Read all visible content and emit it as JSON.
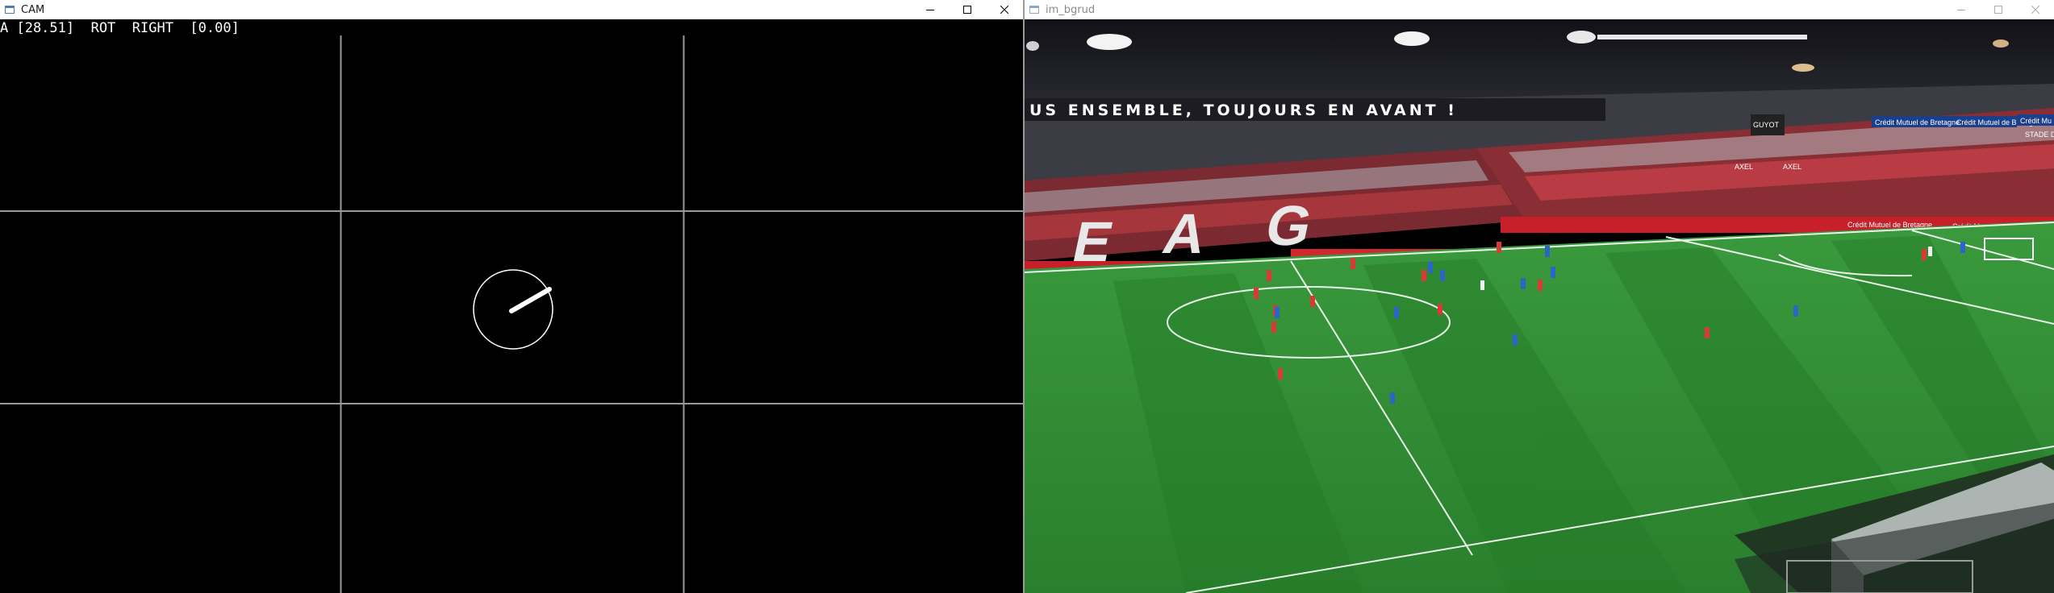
{
  "windows": {
    "cam": {
      "title": "CAM",
      "readout": "A [28.51]  ROT  RIGHT  [0.00]",
      "line_color": "#9a9a9a",
      "gauge_color": "#ffffff"
    },
    "bgrud": {
      "title": "im_bgrud",
      "banner_text": "US  ENSEMBLE,  TOUJOURS  EN  AVANT !",
      "stand_letters": "EAG",
      "ads": [
        "Crédit Mutuel de Bretagne",
        "Crédit Mutuel de Bretagne",
        "Crédit Mu",
        "STADE D",
        "GUYOT",
        "AXEL",
        "AXEL",
        "cuisinella",
        "Crédit Mutuel de Bretagne",
        "Crédit Mutuel de Bretagne"
      ],
      "pitch_color": "#2f8a33",
      "team_colors": {
        "home": "#d83a36",
        "away": "#2e63c8"
      }
    }
  },
  "icons": {
    "app": "app-window-icon",
    "minimize": "minimize-icon",
    "maximize": "maximize-icon",
    "close": "close-icon"
  }
}
